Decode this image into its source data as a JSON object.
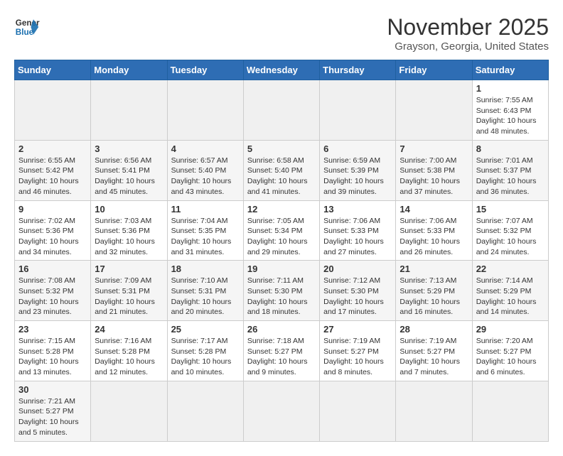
{
  "header": {
    "logo_line1": "General",
    "logo_line2": "Blue",
    "title": "November 2025",
    "location": "Grayson, Georgia, United States"
  },
  "days_of_week": [
    "Sunday",
    "Monday",
    "Tuesday",
    "Wednesday",
    "Thursday",
    "Friday",
    "Saturday"
  ],
  "weeks": [
    [
      {
        "day": "",
        "info": ""
      },
      {
        "day": "",
        "info": ""
      },
      {
        "day": "",
        "info": ""
      },
      {
        "day": "",
        "info": ""
      },
      {
        "day": "",
        "info": ""
      },
      {
        "day": "",
        "info": ""
      },
      {
        "day": "1",
        "info": "Sunrise: 7:55 AM\nSunset: 6:43 PM\nDaylight: 10 hours\nand 48 minutes."
      }
    ],
    [
      {
        "day": "2",
        "info": "Sunrise: 6:55 AM\nSunset: 5:42 PM\nDaylight: 10 hours\nand 46 minutes."
      },
      {
        "day": "3",
        "info": "Sunrise: 6:56 AM\nSunset: 5:41 PM\nDaylight: 10 hours\nand 45 minutes."
      },
      {
        "day": "4",
        "info": "Sunrise: 6:57 AM\nSunset: 5:40 PM\nDaylight: 10 hours\nand 43 minutes."
      },
      {
        "day": "5",
        "info": "Sunrise: 6:58 AM\nSunset: 5:40 PM\nDaylight: 10 hours\nand 41 minutes."
      },
      {
        "day": "6",
        "info": "Sunrise: 6:59 AM\nSunset: 5:39 PM\nDaylight: 10 hours\nand 39 minutes."
      },
      {
        "day": "7",
        "info": "Sunrise: 7:00 AM\nSunset: 5:38 PM\nDaylight: 10 hours\nand 37 minutes."
      },
      {
        "day": "8",
        "info": "Sunrise: 7:01 AM\nSunset: 5:37 PM\nDaylight: 10 hours\nand 36 minutes."
      }
    ],
    [
      {
        "day": "9",
        "info": "Sunrise: 7:02 AM\nSunset: 5:36 PM\nDaylight: 10 hours\nand 34 minutes."
      },
      {
        "day": "10",
        "info": "Sunrise: 7:03 AM\nSunset: 5:36 PM\nDaylight: 10 hours\nand 32 minutes."
      },
      {
        "day": "11",
        "info": "Sunrise: 7:04 AM\nSunset: 5:35 PM\nDaylight: 10 hours\nand 31 minutes."
      },
      {
        "day": "12",
        "info": "Sunrise: 7:05 AM\nSunset: 5:34 PM\nDaylight: 10 hours\nand 29 minutes."
      },
      {
        "day": "13",
        "info": "Sunrise: 7:06 AM\nSunset: 5:33 PM\nDaylight: 10 hours\nand 27 minutes."
      },
      {
        "day": "14",
        "info": "Sunrise: 7:06 AM\nSunset: 5:33 PM\nDaylight: 10 hours\nand 26 minutes."
      },
      {
        "day": "15",
        "info": "Sunrise: 7:07 AM\nSunset: 5:32 PM\nDaylight: 10 hours\nand 24 minutes."
      }
    ],
    [
      {
        "day": "16",
        "info": "Sunrise: 7:08 AM\nSunset: 5:32 PM\nDaylight: 10 hours\nand 23 minutes."
      },
      {
        "day": "17",
        "info": "Sunrise: 7:09 AM\nSunset: 5:31 PM\nDaylight: 10 hours\nand 21 minutes."
      },
      {
        "day": "18",
        "info": "Sunrise: 7:10 AM\nSunset: 5:31 PM\nDaylight: 10 hours\nand 20 minutes."
      },
      {
        "day": "19",
        "info": "Sunrise: 7:11 AM\nSunset: 5:30 PM\nDaylight: 10 hours\nand 18 minutes."
      },
      {
        "day": "20",
        "info": "Sunrise: 7:12 AM\nSunset: 5:30 PM\nDaylight: 10 hours\nand 17 minutes."
      },
      {
        "day": "21",
        "info": "Sunrise: 7:13 AM\nSunset: 5:29 PM\nDaylight: 10 hours\nand 16 minutes."
      },
      {
        "day": "22",
        "info": "Sunrise: 7:14 AM\nSunset: 5:29 PM\nDaylight: 10 hours\nand 14 minutes."
      }
    ],
    [
      {
        "day": "23",
        "info": "Sunrise: 7:15 AM\nSunset: 5:28 PM\nDaylight: 10 hours\nand 13 minutes."
      },
      {
        "day": "24",
        "info": "Sunrise: 7:16 AM\nSunset: 5:28 PM\nDaylight: 10 hours\nand 12 minutes."
      },
      {
        "day": "25",
        "info": "Sunrise: 7:17 AM\nSunset: 5:28 PM\nDaylight: 10 hours\nand 10 minutes."
      },
      {
        "day": "26",
        "info": "Sunrise: 7:18 AM\nSunset: 5:27 PM\nDaylight: 10 hours\nand 9 minutes."
      },
      {
        "day": "27",
        "info": "Sunrise: 7:19 AM\nSunset: 5:27 PM\nDaylight: 10 hours\nand 8 minutes."
      },
      {
        "day": "28",
        "info": "Sunrise: 7:19 AM\nSunset: 5:27 PM\nDaylight: 10 hours\nand 7 minutes."
      },
      {
        "day": "29",
        "info": "Sunrise: 7:20 AM\nSunset: 5:27 PM\nDaylight: 10 hours\nand 6 minutes."
      }
    ],
    [
      {
        "day": "30",
        "info": "Sunrise: 7:21 AM\nSunset: 5:27 PM\nDaylight: 10 hours\nand 5 minutes."
      },
      {
        "day": "",
        "info": ""
      },
      {
        "day": "",
        "info": ""
      },
      {
        "day": "",
        "info": ""
      },
      {
        "day": "",
        "info": ""
      },
      {
        "day": "",
        "info": ""
      },
      {
        "day": "",
        "info": ""
      }
    ]
  ]
}
